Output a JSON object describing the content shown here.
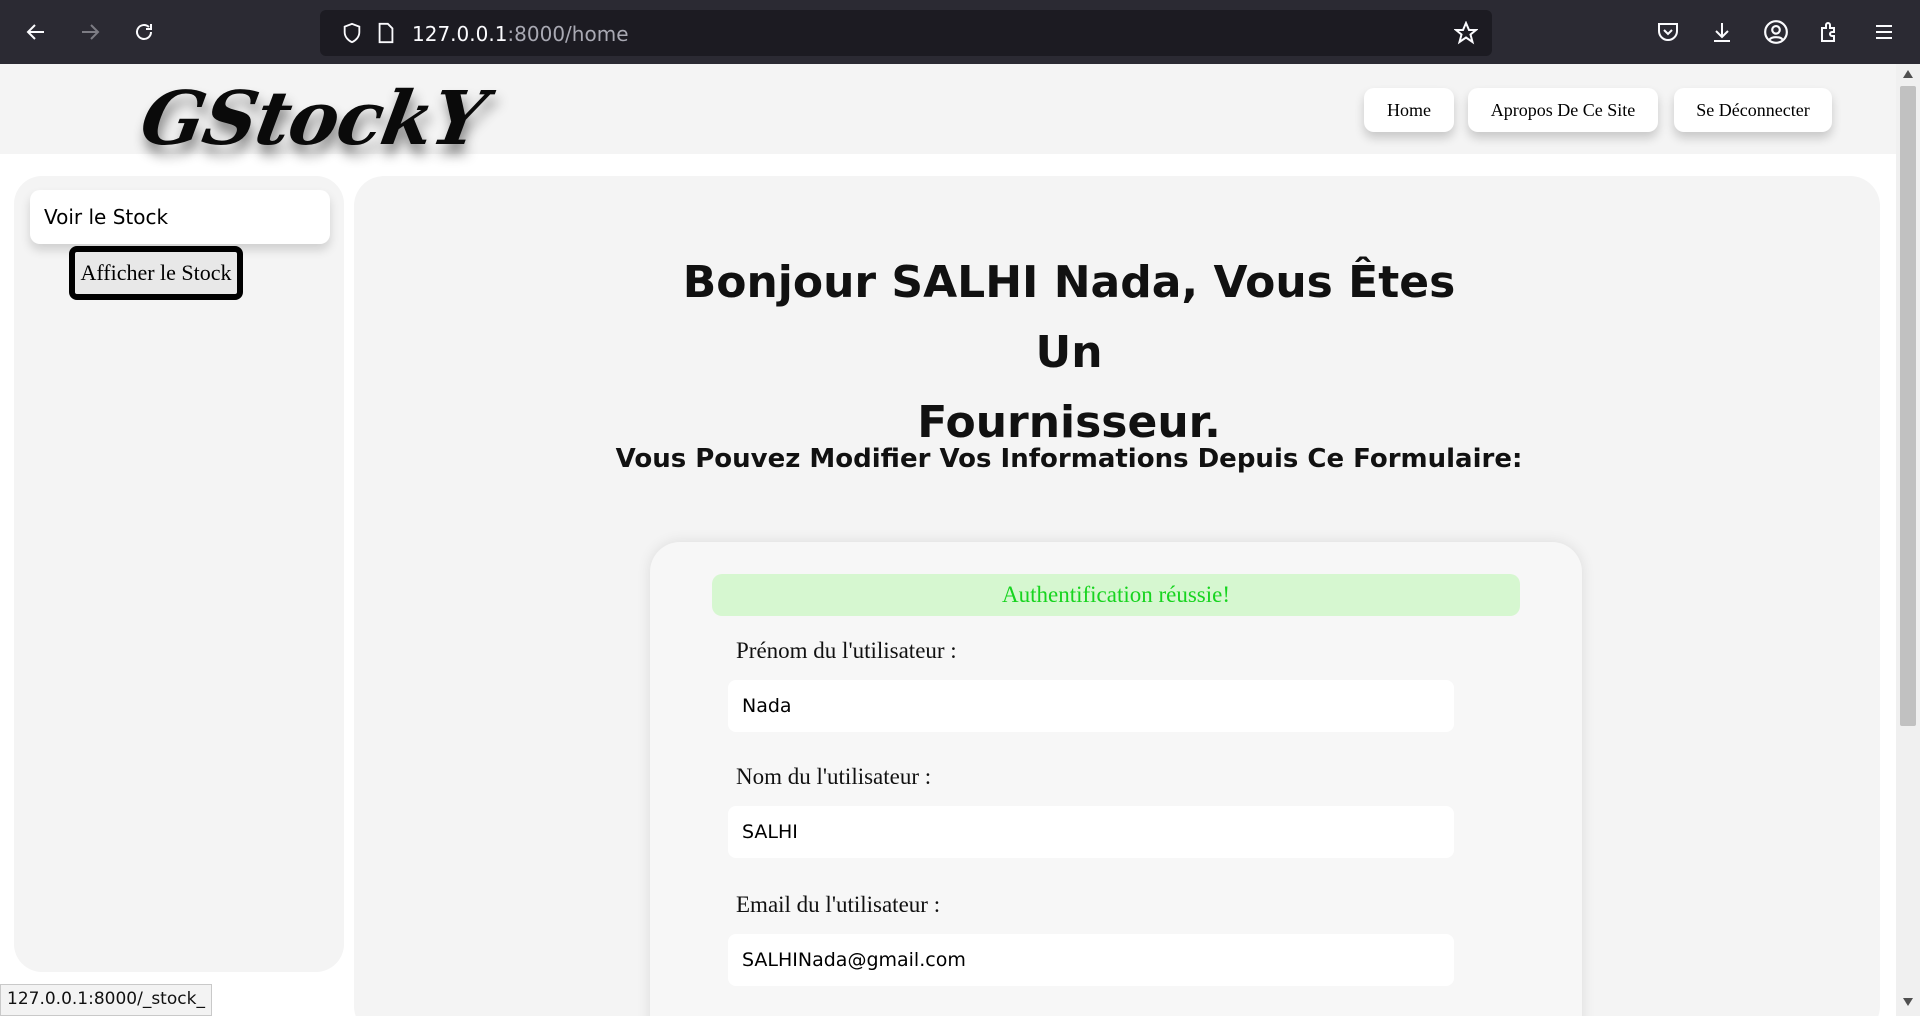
{
  "browser": {
    "url_host": "127.0.0.1",
    "url_path": ":8000/home",
    "status_url": "127.0.0.1:8000/_stock_"
  },
  "site": {
    "logo": "GStockY",
    "nav": [
      {
        "label": "Home"
      },
      {
        "label": "Apropos De Ce Site"
      },
      {
        "label": "Se Déconnecter"
      }
    ]
  },
  "sidebar": {
    "title": "Voir le Stock",
    "button_label": "Afficher le Stock"
  },
  "main": {
    "greeting_line1": "Bonjour SALHI Nada, Vous Êtes Un",
    "greeting_line2": "Fournisseur.",
    "subtitle": "Vous Pouvez Modifier Vos Informations Depuis Ce Formulaire:"
  },
  "form": {
    "alert": "Authentification réussie!",
    "first_name_label": "Prénom du l'utilisateur :",
    "first_name_value": "Nada",
    "last_name_label": "Nom du l'utilisateur :",
    "last_name_value": "SALHI",
    "email_label": "Email du l'utilisateur :",
    "email_value": "SALHINada@gmail.com"
  }
}
